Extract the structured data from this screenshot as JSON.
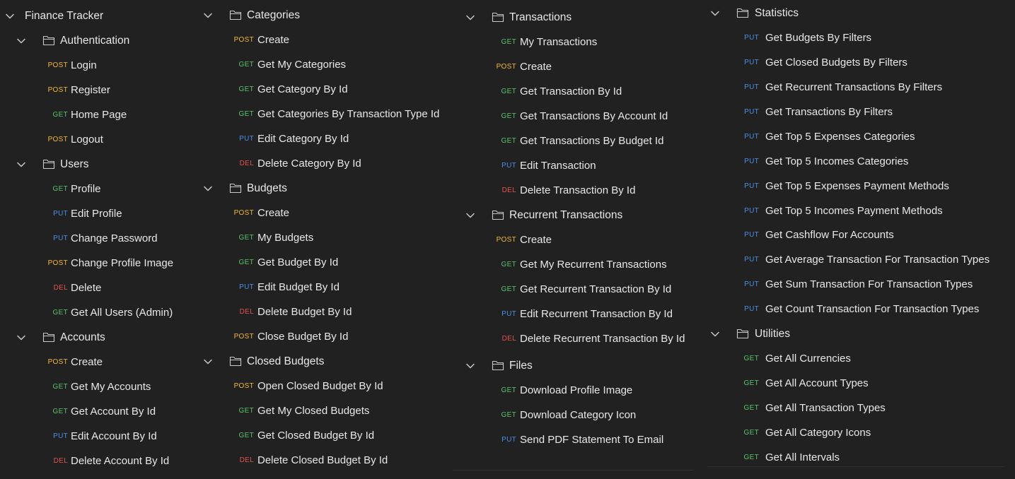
{
  "colors": {
    "background": "#212121",
    "text": "#e8e8e8",
    "GET": "#5ac26f",
    "POST": "#f2b83b",
    "PUT": "#4b8fe6",
    "DEL": "#e0534f"
  },
  "columns": [
    {
      "rows": [
        {
          "kind": "root",
          "label": "Finance Tracker",
          "icon": "chevron-down-icon"
        },
        {
          "kind": "folder",
          "label": "Authentication",
          "icon": "folder-icon"
        },
        {
          "kind": "request",
          "method": "POST",
          "label": "Login"
        },
        {
          "kind": "request",
          "method": "POST",
          "label": "Register"
        },
        {
          "kind": "request",
          "method": "GET",
          "label": "Home Page"
        },
        {
          "kind": "request",
          "method": "POST",
          "label": "Logout"
        },
        {
          "kind": "folder",
          "label": "Users",
          "icon": "folder-icon"
        },
        {
          "kind": "request",
          "method": "GET",
          "label": "Profile"
        },
        {
          "kind": "request",
          "method": "PUT",
          "label": "Edit Profile"
        },
        {
          "kind": "request",
          "method": "PUT",
          "label": "Change Password"
        },
        {
          "kind": "request",
          "method": "POST",
          "label": "Change Profile Image"
        },
        {
          "kind": "request",
          "method": "DEL",
          "label": "Delete"
        },
        {
          "kind": "request",
          "method": "GET",
          "label": "Get All Users (Admin)"
        },
        {
          "kind": "folder",
          "label": "Accounts",
          "icon": "folder-icon"
        },
        {
          "kind": "request",
          "method": "POST",
          "label": "Create"
        },
        {
          "kind": "request",
          "method": "GET",
          "label": "Get My Accounts"
        },
        {
          "kind": "request",
          "method": "GET",
          "label": "Get Account By Id"
        },
        {
          "kind": "request",
          "method": "PUT",
          "label": "Edit Account By Id"
        },
        {
          "kind": "request",
          "method": "DEL",
          "label": "Delete Account By Id"
        }
      ]
    },
    {
      "rows": [
        {
          "kind": "folder",
          "label": "Categories",
          "icon": "folder-icon"
        },
        {
          "kind": "request",
          "method": "POST",
          "label": "Create"
        },
        {
          "kind": "request",
          "method": "GET",
          "label": "Get My Categories"
        },
        {
          "kind": "request",
          "method": "GET",
          "label": "Get Category By Id"
        },
        {
          "kind": "request",
          "method": "GET",
          "label": "Get Categories By Transaction Type Id"
        },
        {
          "kind": "request",
          "method": "PUT",
          "label": "Edit Category By Id"
        },
        {
          "kind": "request",
          "method": "DEL",
          "label": "Delete Category By Id"
        },
        {
          "kind": "folder",
          "label": "Budgets",
          "icon": "folder-icon"
        },
        {
          "kind": "request",
          "method": "POST",
          "label": "Create"
        },
        {
          "kind": "request",
          "method": "GET",
          "label": "My Budgets"
        },
        {
          "kind": "request",
          "method": "GET",
          "label": "Get Budget By Id"
        },
        {
          "kind": "request",
          "method": "PUT",
          "label": "Edit Budget By Id"
        },
        {
          "kind": "request",
          "method": "DEL",
          "label": "Delete Budget By Id"
        },
        {
          "kind": "request",
          "method": "POST",
          "label": "Close Budget By Id"
        },
        {
          "kind": "folder",
          "label": "Closed Budgets",
          "icon": "folder-icon"
        },
        {
          "kind": "request",
          "method": "POST",
          "label": "Open Closed Budget By Id"
        },
        {
          "kind": "request",
          "method": "GET",
          "label": "Get My Closed Budgets"
        },
        {
          "kind": "request",
          "method": "GET",
          "label": "Get Closed Budget By Id"
        },
        {
          "kind": "request",
          "method": "DEL",
          "label": "Delete Closed Budget By Id"
        }
      ]
    },
    {
      "rows": [
        {
          "kind": "folder",
          "label": "Transactions",
          "icon": "folder-icon"
        },
        {
          "kind": "request",
          "method": "GET",
          "label": "My Transactions"
        },
        {
          "kind": "request",
          "method": "POST",
          "label": "Create"
        },
        {
          "kind": "request",
          "method": "GET",
          "label": "Get Transaction By Id"
        },
        {
          "kind": "request",
          "method": "GET",
          "label": "Get Transactions By Account Id"
        },
        {
          "kind": "request",
          "method": "GET",
          "label": "Get Transactions By Budget Id"
        },
        {
          "kind": "request",
          "method": "PUT",
          "label": "Edit Transaction"
        },
        {
          "kind": "request",
          "method": "DEL",
          "label": "Delete Transaction By Id"
        },
        {
          "kind": "folder",
          "label": "Recurrent Transactions",
          "icon": "folder-icon"
        },
        {
          "kind": "request",
          "method": "POST",
          "label": "Create"
        },
        {
          "kind": "request",
          "method": "GET",
          "label": "Get My Recurrent Transactions"
        },
        {
          "kind": "request",
          "method": "GET",
          "label": "Get Recurrent Transaction By Id"
        },
        {
          "kind": "request",
          "method": "PUT",
          "label": "Edit Recurrent Transaction By Id"
        },
        {
          "kind": "request",
          "method": "DEL",
          "label": "Delete Recurrent Transaction By Id"
        },
        {
          "kind": "folder",
          "label": "Files",
          "icon": "folder-icon"
        },
        {
          "kind": "request",
          "method": "GET",
          "label": "Download Profile Image"
        },
        {
          "kind": "request",
          "method": "GET",
          "label": "Download Category Icon"
        },
        {
          "kind": "request",
          "method": "PUT",
          "label": "Send PDF Statement To Email"
        }
      ]
    },
    {
      "rows": [
        {
          "kind": "folder",
          "label": "Statistics",
          "icon": "folder-icon"
        },
        {
          "kind": "request",
          "method": "PUT",
          "label": "Get Budgets By Filters"
        },
        {
          "kind": "request",
          "method": "PUT",
          "label": "Get Closed Budgets By Filters"
        },
        {
          "kind": "request",
          "method": "PUT",
          "label": "Get Recurrent Transactions By Filters"
        },
        {
          "kind": "request",
          "method": "PUT",
          "label": "Get Transactions By Filters"
        },
        {
          "kind": "request",
          "method": "PUT",
          "label": "Get Top 5 Expenses Categories"
        },
        {
          "kind": "request",
          "method": "PUT",
          "label": "Get Top 5 Incomes Categories"
        },
        {
          "kind": "request",
          "method": "PUT",
          "label": "Get Top 5 Expenses Payment Methods"
        },
        {
          "kind": "request",
          "method": "PUT",
          "label": "Get Top 5 Incomes Payment Methods"
        },
        {
          "kind": "request",
          "method": "PUT",
          "label": "Get Cashflow For Accounts"
        },
        {
          "kind": "request",
          "method": "PUT",
          "label": "Get Average Transaction For Transaction Types"
        },
        {
          "kind": "request",
          "method": "PUT",
          "label": "Get Sum Transaction For Transaction Types"
        },
        {
          "kind": "request",
          "method": "PUT",
          "label": "Get Count Transaction For Transaction Types"
        },
        {
          "kind": "folder",
          "label": "Utilities",
          "icon": "folder-icon"
        },
        {
          "kind": "request",
          "method": "GET",
          "label": "Get All Currencies"
        },
        {
          "kind": "request",
          "method": "GET",
          "label": "Get All Account Types"
        },
        {
          "kind": "request",
          "method": "GET",
          "label": "Get All Transaction Types"
        },
        {
          "kind": "request",
          "method": "GET",
          "label": "Get All Category Icons"
        },
        {
          "kind": "request",
          "method": "GET",
          "label": "Get All Intervals"
        }
      ]
    }
  ]
}
